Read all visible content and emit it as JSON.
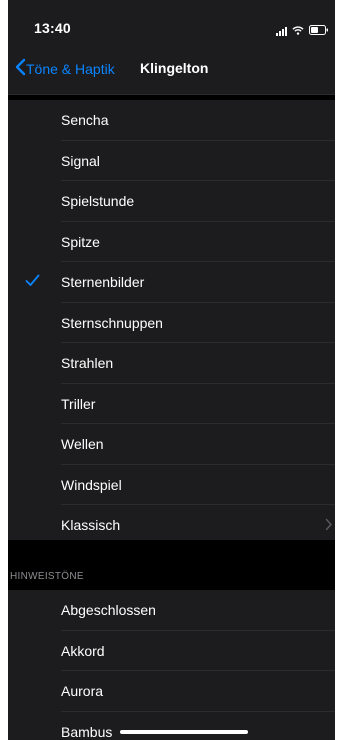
{
  "status": {
    "time": "13:40"
  },
  "nav": {
    "back_label": "Töne & Haptik",
    "title": "Klingelton"
  },
  "ringtones": [
    {
      "label": "Sencha",
      "selected": false,
      "chevron": false
    },
    {
      "label": "Signal",
      "selected": false,
      "chevron": false
    },
    {
      "label": "Spielstunde",
      "selected": false,
      "chevron": false
    },
    {
      "label": "Spitze",
      "selected": false,
      "chevron": false
    },
    {
      "label": "Sternenbilder",
      "selected": true,
      "chevron": false
    },
    {
      "label": "Sternschnuppen",
      "selected": false,
      "chevron": false
    },
    {
      "label": "Strahlen",
      "selected": false,
      "chevron": false
    },
    {
      "label": "Triller",
      "selected": false,
      "chevron": false
    },
    {
      "label": "Wellen",
      "selected": false,
      "chevron": false
    },
    {
      "label": "Windspiel",
      "selected": false,
      "chevron": false
    },
    {
      "label": "Klassisch",
      "selected": false,
      "chevron": true
    }
  ],
  "alert_section": {
    "header": "HINWEISTÖNE",
    "items": [
      {
        "label": "Abgeschlossen"
      },
      {
        "label": "Akkord"
      },
      {
        "label": "Aurora"
      },
      {
        "label": "Bambus"
      }
    ]
  },
  "colors": {
    "accent": "#0a84ff",
    "cell": "#1c1c1e",
    "background": "#000000",
    "separator": "#2c2c2e"
  },
  "icons": {
    "back": "chevron-left-icon",
    "selected": "checkmark-icon",
    "disclosure": "chevron-right-icon"
  }
}
